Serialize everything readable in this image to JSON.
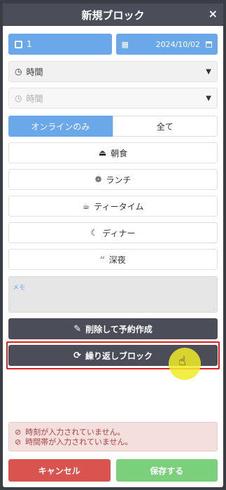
{
  "dialog": {
    "title": "新規ブロック",
    "close_icon": "×"
  },
  "fields": {
    "count_value": "1",
    "date_value": "2024/10/02",
    "time_select": "時間",
    "time_select2": "時間"
  },
  "tabs": {
    "online_only": "オンラインのみ",
    "all": "全て"
  },
  "meals": [
    {
      "icon": "⏏",
      "label": "朝食"
    },
    {
      "icon": "❁",
      "label": "ランチ"
    },
    {
      "icon": "☕",
      "label": "ティータイム"
    },
    {
      "icon": "☾",
      "label": "ディナー"
    },
    {
      "icon": "ᶻᶻ",
      "label": "深夜"
    }
  ],
  "memo": {
    "placeholder": "メモ"
  },
  "actions": {
    "delete_and_reserve": "削除して予約作成",
    "repeat_block": "繰り返しブロック"
  },
  "errors": {
    "line1": "時刻が入力されていません。",
    "line2": "時間帯が入力されていません。"
  },
  "footer": {
    "cancel": "キャンセル",
    "save": "保存する"
  },
  "colors": {
    "header": "#4b4d59",
    "blue": "#6aa8ea",
    "danger": "#d9534f",
    "success": "#7bd07b"
  }
}
